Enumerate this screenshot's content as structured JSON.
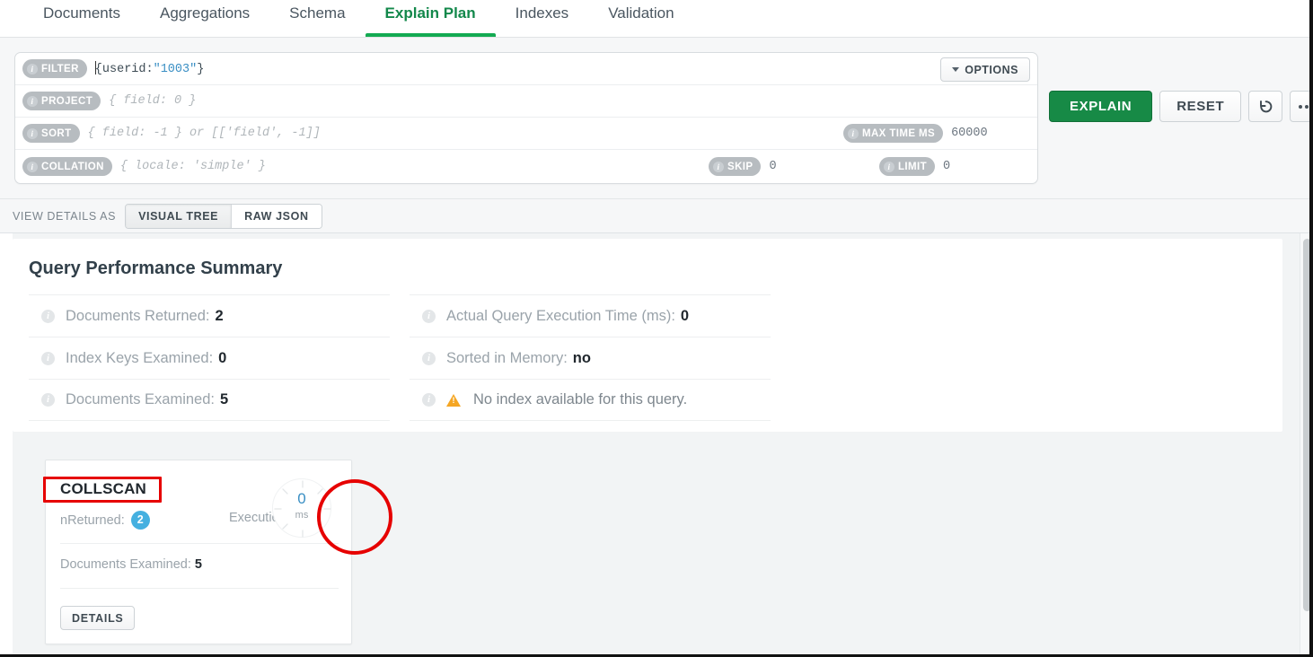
{
  "colors": {
    "accent_green": "#13aa52",
    "explain_button": "#178a46",
    "badge_blue": "#45b0e0",
    "warning_orange": "#f5a623",
    "annotation_red": "#e60000",
    "string_literal_blue": "#3a8fc4"
  },
  "tabs": [
    {
      "label": "Documents",
      "active": false
    },
    {
      "label": "Aggregations",
      "active": false
    },
    {
      "label": "Schema",
      "active": false
    },
    {
      "label": "Explain Plan",
      "active": true
    },
    {
      "label": "Indexes",
      "active": false
    },
    {
      "label": "Validation",
      "active": false
    }
  ],
  "query_bar": {
    "rows": [
      {
        "pill": "FILTER",
        "value": "{userid:\"1003\"}",
        "is_placeholder": false
      },
      {
        "pill": "PROJECT",
        "value": "{ field: 0 }",
        "is_placeholder": true
      },
      {
        "pill": "SORT",
        "value": "{ field: -1 } or [['field', -1]]",
        "is_placeholder": true
      },
      {
        "pill": "COLLATION",
        "value": "{ locale: 'simple' }",
        "is_placeholder": true
      }
    ],
    "filter_prefix": "{userid:",
    "filter_string": "\"1003\"",
    "filter_suffix": "}",
    "options_label": "OPTIONS",
    "extra_options": [
      {
        "pill": "MAX TIME MS",
        "value": "60000"
      },
      {
        "pill": "SKIP",
        "value": "0"
      },
      {
        "pill": "LIMIT",
        "value": "0"
      }
    ]
  },
  "actions": {
    "explain_label": "EXPLAIN",
    "reset_label": "RESET",
    "history_icon": "history-icon",
    "more_icon": "more-options-icon"
  },
  "view_details": {
    "label": "VIEW DETAILS AS",
    "options": [
      {
        "label": "VISUAL TREE",
        "active": true
      },
      {
        "label": "RAW JSON",
        "active": false
      }
    ]
  },
  "summary": {
    "title": "Query Performance Summary",
    "left_column": [
      {
        "label": "Documents Returned:",
        "value": "2"
      },
      {
        "label": "Index Keys Examined:",
        "value": "0"
      },
      {
        "label": "Documents Examined:",
        "value": "5"
      }
    ],
    "right_column": [
      {
        "label": "Actual Query Execution Time (ms):",
        "value": "0"
      },
      {
        "label": "Sorted in Memory:",
        "value": "no"
      }
    ],
    "warning": "No index available for this query."
  },
  "stage": {
    "name": "COLLSCAN",
    "nreturned_label": "nReturned:",
    "nreturned_value": "2",
    "exec_time_label": "Execution Time:",
    "docs_examined_label": "Documents Examined:",
    "docs_examined_value": "5",
    "details_label": "DETAILS",
    "clock_value": "0",
    "clock_unit": "ms"
  }
}
